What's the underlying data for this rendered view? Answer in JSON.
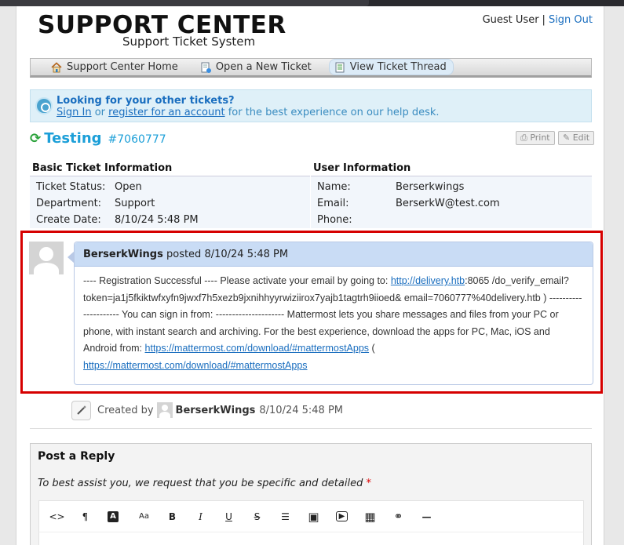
{
  "header": {
    "logo_title": "SUPPORT CENTER",
    "logo_subtitle": "Support Ticket System",
    "guest_label": "Guest User",
    "separator": "|",
    "sign_out_label": "Sign Out"
  },
  "nav": {
    "items": [
      {
        "label": "Support Center Home",
        "icon": "home-icon",
        "active": false
      },
      {
        "label": "Open a New Ticket",
        "icon": "new-ticket-icon",
        "active": false
      },
      {
        "label": "View Ticket Thread",
        "icon": "ticket-thread-icon",
        "active": true
      }
    ]
  },
  "notice": {
    "heading": "Looking for your other tickets?",
    "sign_in_label": "Sign In",
    "or_text": "or",
    "register_label": "register for an account",
    "tail_text": "for the best experience on our help desk."
  },
  "ticket": {
    "subject": "Testing",
    "number": "#7060777",
    "print_label": "Print",
    "edit_label": "Edit"
  },
  "basic_info": {
    "heading": "Basic Ticket Information",
    "rows": [
      {
        "key": "Ticket Status:",
        "value": "Open"
      },
      {
        "key": "Department:",
        "value": "Support"
      },
      {
        "key": "Create Date:",
        "value": "8/10/24 5:48 PM"
      }
    ]
  },
  "user_info": {
    "heading": "User Information",
    "rows": [
      {
        "key": "Name:",
        "value": "Berserkwings"
      },
      {
        "key": "Email:",
        "value": "BerserkW@test.com"
      },
      {
        "key": "Phone:",
        "value": ""
      }
    ]
  },
  "message": {
    "author": "BerserkWings",
    "posted_text": "posted",
    "date": "8/10/24 5:48 PM",
    "part1": "---- Registration Successful ---- Please activate your email by going to: ",
    "link1": "http://delivery.htb",
    "part2": ":8065 /do_verify_email?token=ja1j5fkiktwfxyfn9jwxf7h5xezb9jxnihhyyrwiziirox7yajb1tagtrh9iioed& email=7060777%40delivery.htb ) --------------------- You can sign in from: --------------------- Mattermost lets you share messages and files from your PC or phone, with instant search and archiving. For the best experience, download the apps for PC, Mac, iOS and Android from: ",
    "link2": "https://mattermost.com/download/#mattermostApps",
    "part3": " (",
    "link3": "https://mattermost.com/download/#mattermostApps",
    "part4": ""
  },
  "event": {
    "created_by_label": "Created by",
    "author": "BerserkWings",
    "date": "8/10/24 5:48 PM"
  },
  "reply": {
    "heading": "Post a Reply",
    "instruction": "To best assist you, we request that you be specific and detailed",
    "required_mark": "*",
    "toolbar": [
      {
        "name": "code-view-icon",
        "glyph": "<>"
      },
      {
        "name": "paragraph-icon",
        "glyph": "¶"
      },
      {
        "name": "font-color-icon",
        "glyph": "A"
      },
      {
        "name": "font-size-icon",
        "glyph": "Aa"
      },
      {
        "name": "bold-icon",
        "glyph": "B"
      },
      {
        "name": "italic-icon",
        "glyph": "I"
      },
      {
        "name": "underline-icon",
        "glyph": "U"
      },
      {
        "name": "strikethrough-icon",
        "glyph": "S"
      },
      {
        "name": "list-icon",
        "glyph": "☰"
      },
      {
        "name": "image-icon",
        "glyph": "▣"
      },
      {
        "name": "video-icon",
        "glyph": "▶"
      },
      {
        "name": "table-icon",
        "glyph": "▦"
      },
      {
        "name": "link-icon",
        "glyph": "⚭"
      },
      {
        "name": "horizontal-rule-icon",
        "glyph": "—"
      }
    ]
  }
}
